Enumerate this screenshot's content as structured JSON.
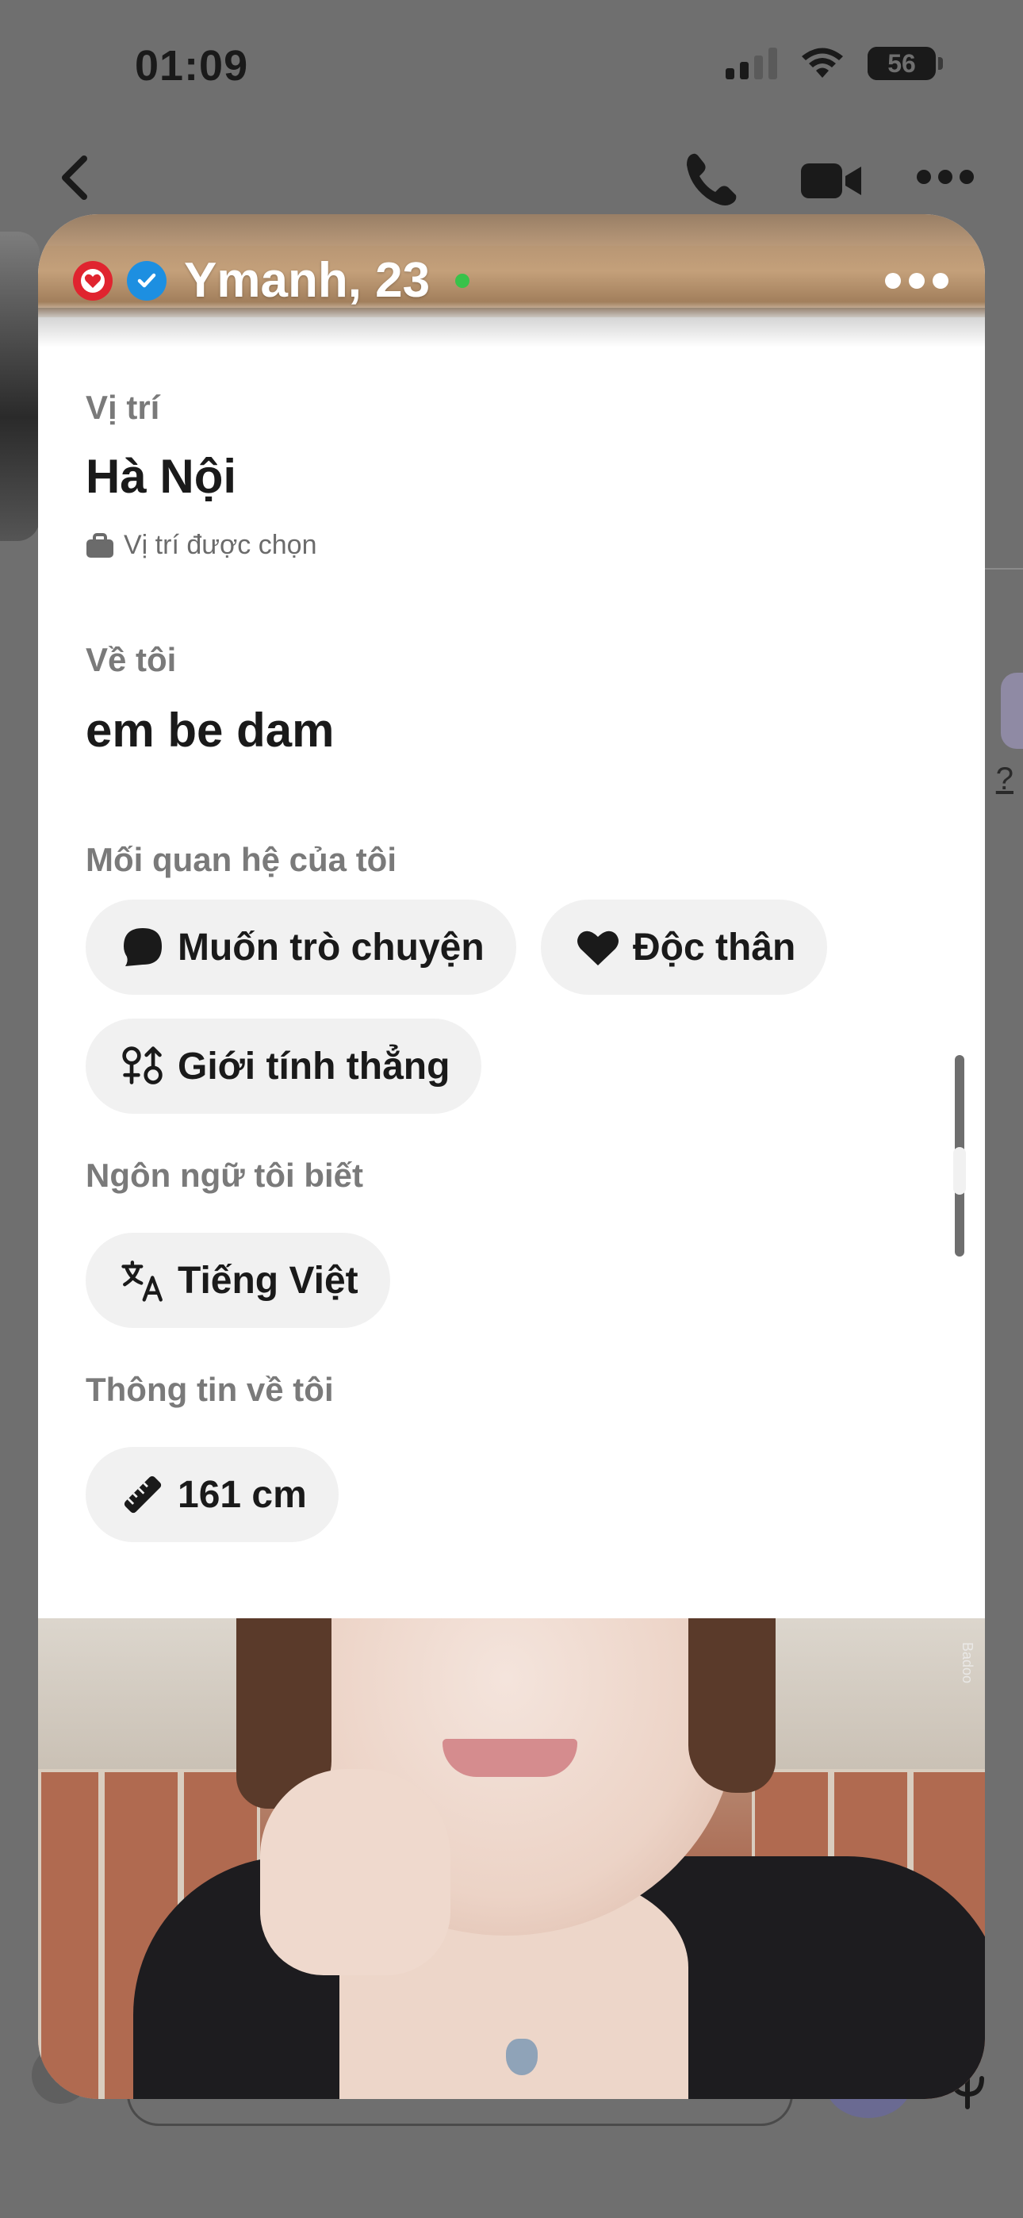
{
  "status_bar": {
    "time": "01:09",
    "battery": "56"
  },
  "chat_header": {
    "back_icon": "chevron-left-icon",
    "call_icon": "phone-icon",
    "video_icon": "video-camera-icon",
    "more_icon": "more-horizontal-icon"
  },
  "background_chat": {
    "partial_link_text": "?"
  },
  "profile": {
    "name": "Ymanh, 23",
    "online": true,
    "colors": {
      "online_dot": "#39c24a",
      "verified": "#1d8fe1",
      "heart_badge": "#e0242f"
    },
    "sections": {
      "location": {
        "label": "Vị trí",
        "value": "Hà Nội",
        "note": "Vị trí được chọn"
      },
      "about": {
        "label": "Về tôi",
        "value": "em be dam"
      },
      "relationship": {
        "label": "Mối quan hệ của tôi",
        "chips": [
          {
            "icon": "chat-bubble-icon",
            "text": "Muốn trò chuyện"
          },
          {
            "icon": "heart-icon",
            "text": "Độc thân"
          },
          {
            "icon": "gender-icon",
            "text": "Giới tính thẳng"
          }
        ]
      },
      "languages": {
        "label": "Ngôn ngữ tôi biết",
        "chips": [
          {
            "icon": "translate-icon",
            "text": "Tiếng Việt"
          }
        ]
      },
      "info": {
        "label": "Thông tin về tôi",
        "chips": [
          {
            "icon": "ruler-icon",
            "text": "161 cm"
          }
        ]
      }
    },
    "photo_watermark": "Badoo",
    "scroll_position": 0.55
  }
}
